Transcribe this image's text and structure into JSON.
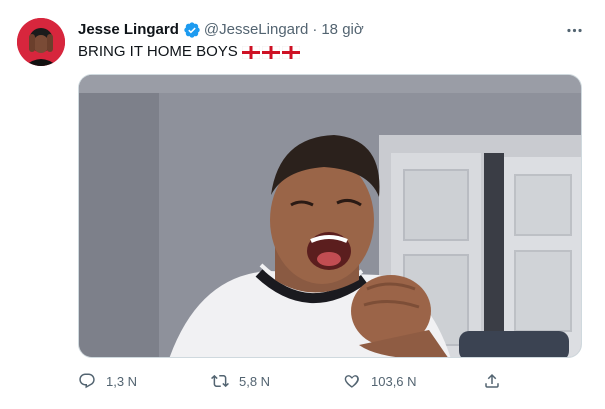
{
  "tweet": {
    "author_name": "Jesse Lingard",
    "handle": "@JesseLingard",
    "separator": "·",
    "timestamp": "18 giờ",
    "text": "BRING IT HOME BOYS",
    "emoji": [
      "england-flag",
      "england-flag",
      "england-flag"
    ]
  },
  "actions": {
    "reply_count": "1,3 N",
    "retweet_count": "5,8 N",
    "like_count": "103,6 N"
  },
  "icons": {
    "verified": "verified-badge-icon",
    "more": "more-options-icon",
    "reply": "reply-icon",
    "retweet": "retweet-icon",
    "like": "like-icon",
    "share": "share-icon"
  },
  "colors": {
    "verified_blue": "#1d9bf0",
    "text_primary": "#0f1419",
    "text_secondary": "#536471",
    "england_red": "#ce1124"
  }
}
